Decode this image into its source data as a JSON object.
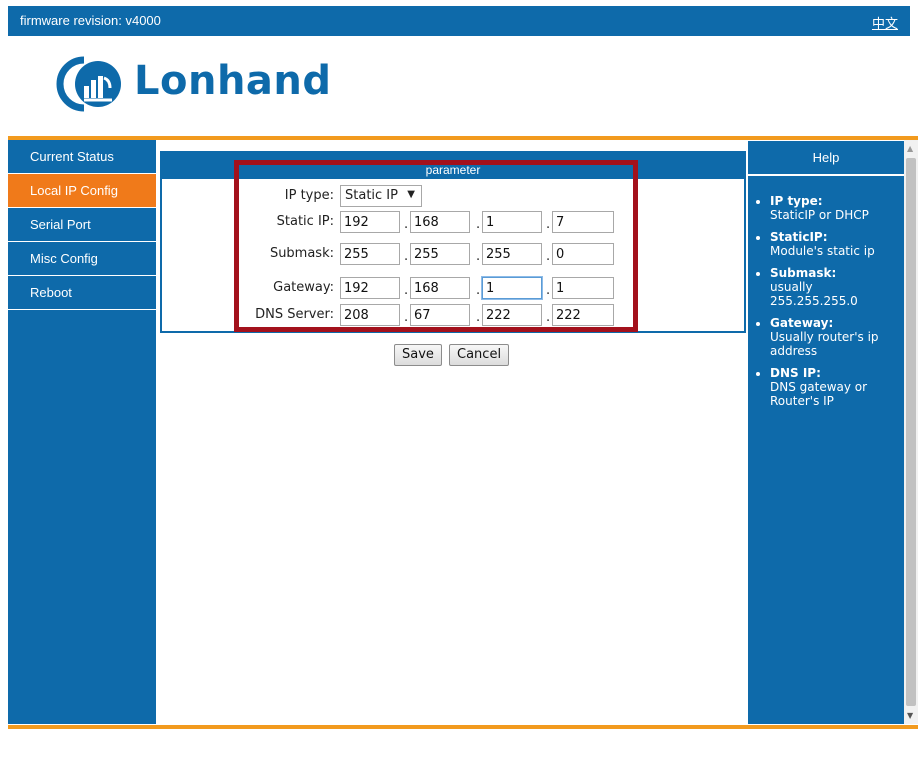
{
  "topbar": {
    "firmware": "firmware revision: v4000",
    "lang": "中文"
  },
  "brand": {
    "name": "Lonhand"
  },
  "sidebar": {
    "items": [
      {
        "label": "Current Status",
        "active": false
      },
      {
        "label": "Local IP Config",
        "active": true
      },
      {
        "label": "Serial Port",
        "active": false
      },
      {
        "label": "Misc Config",
        "active": false
      },
      {
        "label": "Reboot",
        "active": false
      }
    ]
  },
  "main": {
    "header": "parameter",
    "ip_type_label": "IP type:",
    "ip_type_value": "Static IP",
    "static_ip_label": "Static IP:",
    "static_ip": [
      "192",
      "168",
      "1",
      "7"
    ],
    "submask_label": "Submask:",
    "submask": [
      "255",
      "255",
      "255",
      "0"
    ],
    "gateway_label": "Gateway:",
    "gateway": [
      "192",
      "168",
      "1",
      "1"
    ],
    "dns_label": "DNS Server:",
    "dns": [
      "208",
      "67",
      "222",
      "222"
    ],
    "dot": "."
  },
  "buttons": {
    "save": "Save",
    "cancel": "Cancel"
  },
  "help": {
    "title": "Help",
    "items": [
      {
        "t": "IP type:",
        "d": "StaticIP or DHCP"
      },
      {
        "t": "StaticIP:",
        "d": "Module's static ip"
      },
      {
        "t": "Submask:",
        "d": "usually 255.255.255.0"
      },
      {
        "t": "Gateway:",
        "d": "Usually router's ip address"
      },
      {
        "t": "DNS IP:",
        "d": "DNS gateway or Router's IP"
      }
    ]
  },
  "colors": {
    "primary": "#0e6aaa",
    "accent": "#f07a1a",
    "highlight": "#a3111c"
  }
}
